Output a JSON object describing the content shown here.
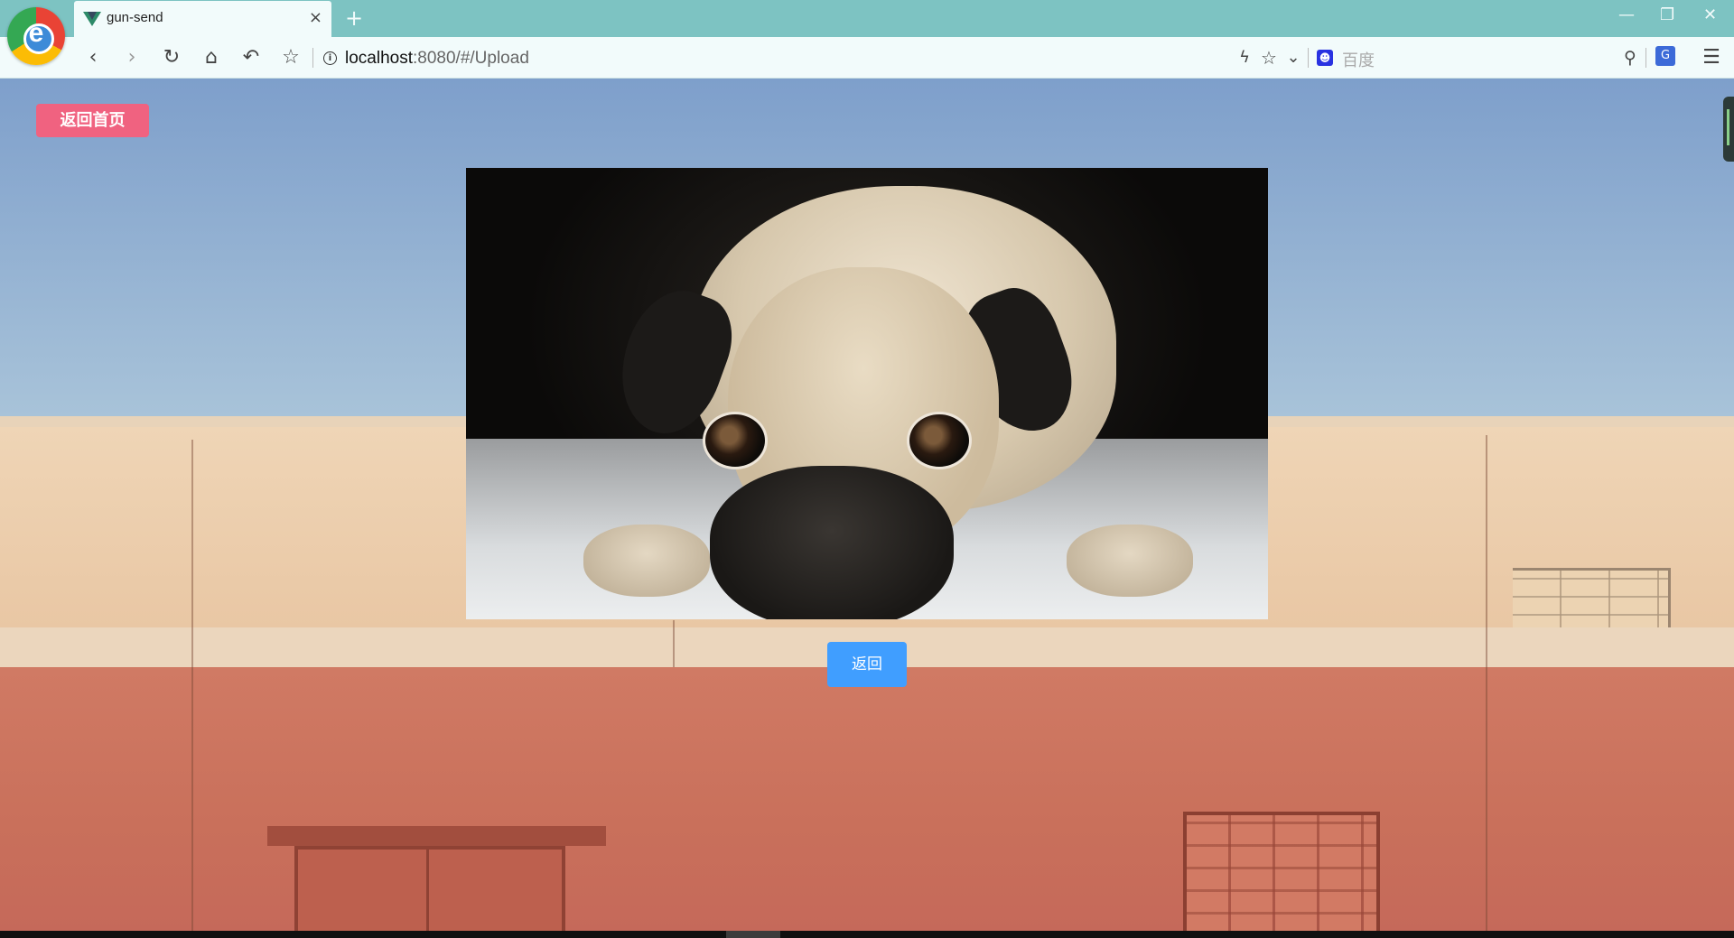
{
  "browser": {
    "tab": {
      "title": "gun-send",
      "close": "×"
    },
    "new_tab": "+",
    "window_controls": {
      "minimize": "—",
      "restore": "❐",
      "close": "✕"
    },
    "nav": {
      "back": "‹",
      "forward": "›",
      "reload": "↻",
      "home": "⌂",
      "undo": "↶",
      "bookmark": "☆"
    },
    "address": {
      "host": "localhost",
      "rest": ":8080/#/Upload"
    },
    "right_icons": {
      "lightning": "ϟ",
      "star": "☆",
      "dropdown": "⌄",
      "search": "⚲",
      "menu": "☰"
    },
    "search": {
      "engine_icon": "baidu-icon",
      "placeholder": "百度"
    }
  },
  "page": {
    "home_button": "返回首页",
    "back_button": "返回",
    "image": {
      "subject": "pug"
    }
  },
  "colors": {
    "titlebar": "#7dc3c2",
    "home_button": "#f06280",
    "back_button": "#409eff"
  }
}
